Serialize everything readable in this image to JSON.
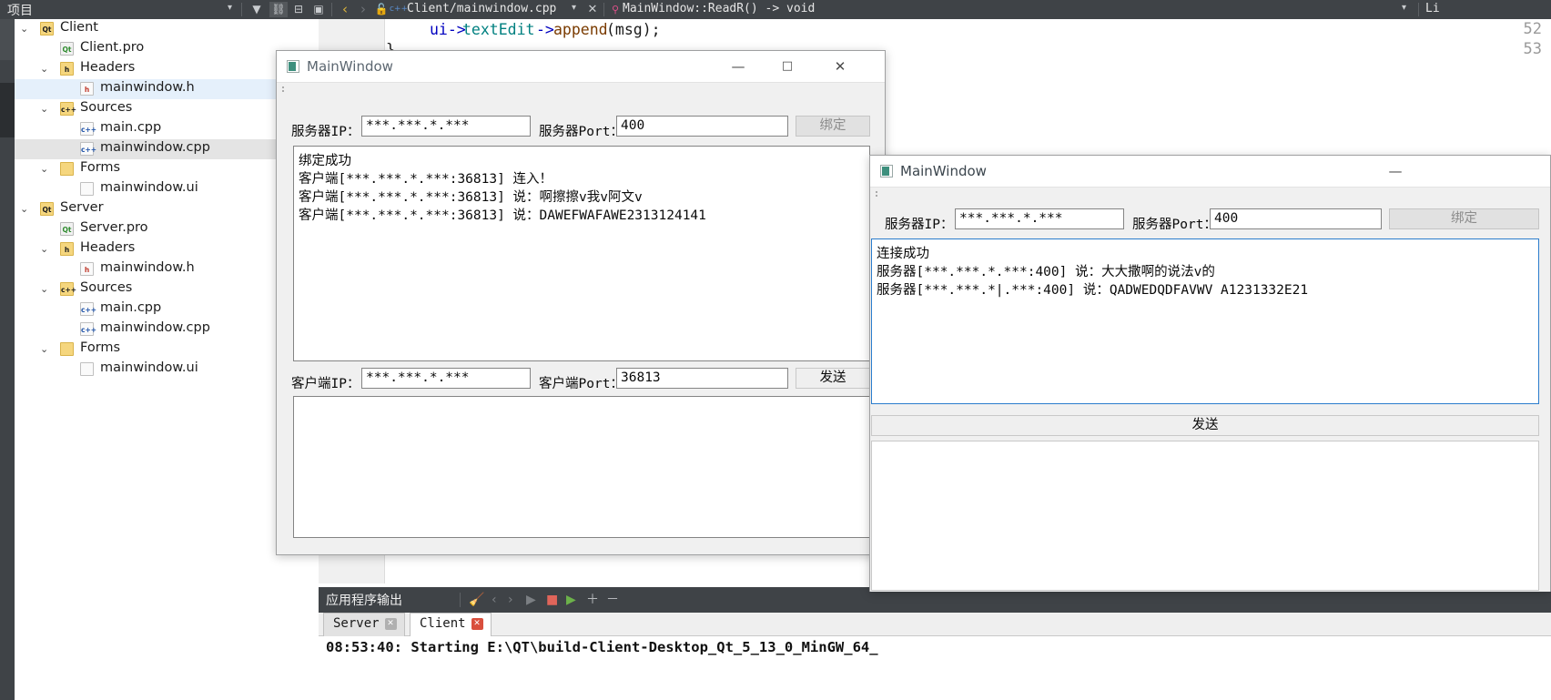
{
  "ide": {
    "panel_title": "项目",
    "toolbar_icons": [
      "filter-icon",
      "link-icon",
      "split-icon",
      "sync-icon"
    ],
    "nav_back_icon": "chevron-left-icon",
    "nav_forward_icon": "chevron-right-icon",
    "lock_icon": "unlock-icon",
    "file_type_icon": "cpp-file-icon",
    "open_file_tab": "Client/mainwindow.cpp",
    "close_tab_icon": "close-icon",
    "symbol_icon": "function-private-icon",
    "current_symbol": "MainWindow::ReadR() -> void",
    "right_label": "Li",
    "tree": [
      {
        "label": "Client",
        "indent": 0,
        "chevron": "down",
        "icon": "project-folder-icon",
        "icon_text": "Qt",
        "icon_class": "ico-folder",
        "selected": "none"
      },
      {
        "label": "Client.pro",
        "indent": 1,
        "chevron": "",
        "icon": "pro-file-icon",
        "icon_text": "Qt",
        "icon_class": "ico-pro",
        "selected": "none"
      },
      {
        "label": "Headers",
        "indent": 1,
        "chevron": "down",
        "icon": "headers-folder-icon",
        "icon_text": "h",
        "icon_class": "ico-folder",
        "selected": "none"
      },
      {
        "label": "mainwindow.h",
        "indent": 2,
        "chevron": "",
        "icon": "header-file-icon",
        "icon_text": "h",
        "icon_class": "ico-h",
        "selected": "blue"
      },
      {
        "label": "Sources",
        "indent": 1,
        "chevron": "down",
        "icon": "sources-folder-icon",
        "icon_text": "c++",
        "icon_class": "ico-folder",
        "selected": "none"
      },
      {
        "label": "main.cpp",
        "indent": 2,
        "chevron": "",
        "icon": "cpp-file-icon",
        "icon_text": "c++",
        "icon_class": "ico-cpp",
        "selected": "none"
      },
      {
        "label": "mainwindow.cpp",
        "indent": 2,
        "chevron": "",
        "icon": "cpp-file-icon",
        "icon_text": "c++",
        "icon_class": "ico-cpp",
        "selected": "grey"
      },
      {
        "label": "Forms",
        "indent": 1,
        "chevron": "down",
        "icon": "forms-folder-icon",
        "icon_text": "",
        "icon_class": "ico-folder",
        "selected": "none"
      },
      {
        "label": "mainwindow.ui",
        "indent": 2,
        "chevron": "",
        "icon": "ui-file-icon",
        "icon_text": "",
        "icon_class": "ico-ui",
        "selected": "none"
      },
      {
        "label": "Server",
        "indent": 0,
        "chevron": "down",
        "icon": "project-folder-icon",
        "icon_text": "Qt",
        "icon_class": "ico-folder",
        "selected": "none"
      },
      {
        "label": "Server.pro",
        "indent": 1,
        "chevron": "",
        "icon": "pro-file-icon",
        "icon_text": "Qt",
        "icon_class": "ico-pro",
        "selected": "none"
      },
      {
        "label": "Headers",
        "indent": 1,
        "chevron": "down",
        "icon": "headers-folder-icon",
        "icon_text": "h",
        "icon_class": "ico-folder",
        "selected": "none"
      },
      {
        "label": "mainwindow.h",
        "indent": 2,
        "chevron": "",
        "icon": "header-file-icon",
        "icon_text": "h",
        "icon_class": "ico-h",
        "selected": "none"
      },
      {
        "label": "Sources",
        "indent": 1,
        "chevron": "down",
        "icon": "sources-folder-icon",
        "icon_text": "c++",
        "icon_class": "ico-folder",
        "selected": "none"
      },
      {
        "label": "main.cpp",
        "indent": 2,
        "chevron": "",
        "icon": "cpp-file-icon",
        "icon_text": "c++",
        "icon_class": "ico-cpp",
        "selected": "none"
      },
      {
        "label": "mainwindow.cpp",
        "indent": 2,
        "chevron": "",
        "icon": "cpp-file-icon",
        "icon_text": "c++",
        "icon_class": "ico-cpp",
        "selected": "none"
      },
      {
        "label": "Forms",
        "indent": 1,
        "chevron": "down",
        "icon": "forms-folder-icon",
        "icon_text": "",
        "icon_class": "ico-folder",
        "selected": "none"
      },
      {
        "label": "mainwindow.ui",
        "indent": 2,
        "chevron": "",
        "icon": "ui-file-icon",
        "icon_text": "",
        "icon_class": "ico-ui",
        "selected": "none"
      }
    ],
    "editor": {
      "line_numbers": [
        "52",
        "53"
      ],
      "code_line_1_a": "ui->",
      "code_line_1_b": "textEdit",
      "code_line_1_c": "->",
      "code_line_1_d": "append",
      "code_line_1_e": "(msg);",
      "code_line_2": "}"
    },
    "output": {
      "title": "应用程序输出",
      "icons": [
        "clear-output-icon",
        "prev-item-icon",
        "next-item-icon",
        "run-icon",
        "stop-icon",
        "rerun-icon",
        "zoom-in-icon",
        "zoom-out-icon"
      ],
      "tabs": [
        {
          "label": "Server",
          "close_icon": "close-icon",
          "active": false
        },
        {
          "label": "Client",
          "close_icon": "close-icon",
          "active": true
        }
      ],
      "line": "08:53:40: Starting E:\\QT\\build-Client-Desktop_Qt_5_13_0_MinGW_64_"
    }
  },
  "client_window": {
    "title": "MainWindow",
    "minimize_label": "—",
    "maximize_label": "□",
    "close_label": "✕",
    "server_ip_label": "服务器IP：",
    "server_ip_value": "***.***.*.***",
    "server_port_label": "服务器Port：",
    "server_port_value": "400",
    "bind_button": "绑定",
    "log_lines": [
      "绑定成功",
      "客户端[***.***.*.***:36813] 连入！",
      "客户端[***.***.*.***:36813] 说：啊擦擦v我v阿文v",
      "客户端[***.***.*.***:36813] 说：DAWEFWAFAWE2313124141"
    ],
    "client_ip_label": "客户端IP：",
    "client_ip_value": "***.***.*.***",
    "client_port_label": "客户端Port：",
    "client_port_value": "36813",
    "send_button": "发送",
    "compose_value": ""
  },
  "server_window": {
    "title": "MainWindow",
    "minimize_label": "—",
    "server_ip_label": "服务器IP：",
    "server_ip_value": "***.***.*.***",
    "server_port_label": "服务器Port：",
    "server_port_value": "400",
    "bind_button": "绑定",
    "log_lines": [
      "连接成功",
      "服务器[***.***.*.***:400] 说：大大撒啊的说法v的",
      "服务器[***.***.*|.***:400] 说：QADWEDQDFAVWV A1231332E21"
    ],
    "send_button": "发送",
    "compose_value": ""
  }
}
